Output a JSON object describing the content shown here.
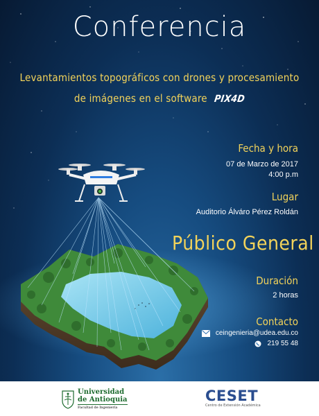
{
  "poster": {
    "title": "Conferencia",
    "subtitle_line1": "Levantamientos topográficos con drones y procesamiento",
    "subtitle_line2": "de imágenes en el software",
    "software_logo": "PIX4D"
  },
  "details": {
    "fecha_label": "Fecha y hora",
    "fecha_value": "07 de Marzo de 2017",
    "hora_value": "4:00 p.m",
    "lugar_label": "Lugar",
    "lugar_value": "Auditorio Álváro Pérez Roldán",
    "publico": "Público General",
    "duracion_label": "Duración",
    "duracion_value": "2 horas",
    "contacto_label": "Contacto",
    "email": "ceingenieria@udea.edu.co",
    "phone": "219 55 48"
  },
  "footer": {
    "udea_line1": "Universidad",
    "udea_line2": "de Antioquia",
    "udea_faculty": "Facultad de Ingeniería",
    "ceset_name": "CESET",
    "ceset_sub": "Centro de Extensión Académica"
  },
  "icons": {
    "email": "envelope-icon",
    "phone": "phone-icon"
  },
  "colors": {
    "accent": "#f3d35a",
    "text": "#ffffff",
    "udea_green": "#1d6b2e",
    "ceset_blue": "#2a4d8f"
  }
}
